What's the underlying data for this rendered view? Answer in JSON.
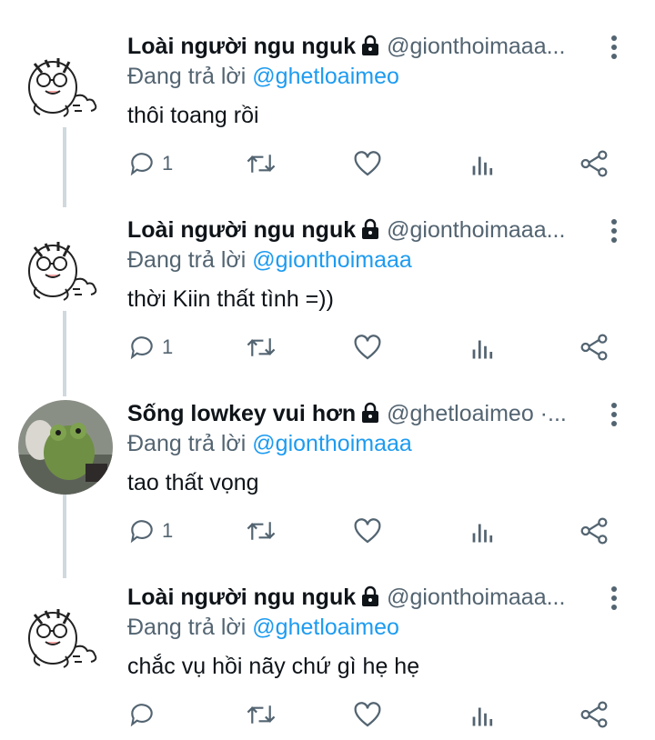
{
  "tweets": [
    {
      "avatar": "tiger-sticker",
      "name": "Loài người ngu nguk",
      "handle": "@gionthoimaaa...",
      "reply_prefix": "Đang trả lời",
      "reply_to": "@ghetloaimeo",
      "text": "thôi toang rồi",
      "reply_count": "1"
    },
    {
      "avatar": "tiger-sticker",
      "name": "Loài người ngu nguk",
      "handle": "@gionthoimaaa...",
      "reply_prefix": "Đang trả lời",
      "reply_to": "@gionthoimaaa",
      "text": "thời Kiin thất tình =))",
      "reply_count": "1"
    },
    {
      "avatar": "frog-plush-photo",
      "name": "Sống lowkey vui hơn",
      "handle": "@ghetloaimeo ·...",
      "reply_prefix": "Đang trả lời",
      "reply_to": "@gionthoimaaa",
      "text": "tao thất vọng",
      "reply_count": "1"
    },
    {
      "avatar": "tiger-sticker",
      "name": "Loài người ngu nguk",
      "handle": "@gionthoimaaa...",
      "reply_prefix": "Đang trả lời",
      "reply_to": "@ghetloaimeo",
      "text": "chắc vụ hồi nãy chứ gì hẹ hẹ",
      "reply_count": ""
    }
  ],
  "icons": [
    "reply-icon",
    "retweet-icon",
    "like-icon",
    "views-icon",
    "share-icon",
    "lock-icon",
    "more-icon"
  ],
  "colors": {
    "name": "#0f1419",
    "handle": "#536471",
    "mention": "#1d9bf0",
    "thread_line": "#cfd9de"
  }
}
